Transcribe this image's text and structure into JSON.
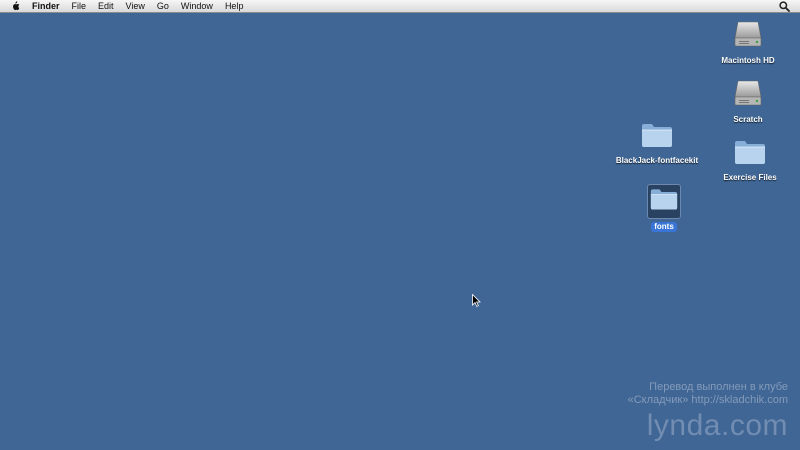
{
  "menubar": {
    "apple_icon": "apple-icon",
    "app_name": "Finder",
    "items": [
      "File",
      "Edit",
      "View",
      "Go",
      "Window",
      "Help"
    ],
    "spotlight_icon": "search-icon"
  },
  "desktop": {
    "icons": {
      "macintosh_hd": {
        "label": "Macintosh HD",
        "kind": "hard-drive-icon"
      },
      "scratch": {
        "label": "Scratch",
        "kind": "hard-drive-icon"
      },
      "blackjack": {
        "label": "BlackJack-fontfacekit",
        "kind": "folder-icon"
      },
      "exercise_files": {
        "label": "Exercise Files",
        "kind": "folder-icon"
      },
      "fonts": {
        "label": "fonts",
        "kind": "folder-icon",
        "selected": true
      }
    }
  },
  "watermark": {
    "line1": "Перевод выполнен в клубе",
    "line2": "«Складчик» http://skladchik.com",
    "brand": "lynda.com"
  },
  "colors": {
    "desktop_bg": "#3f6695",
    "selection": "#3875d7",
    "folder": "#a9c7e6"
  }
}
